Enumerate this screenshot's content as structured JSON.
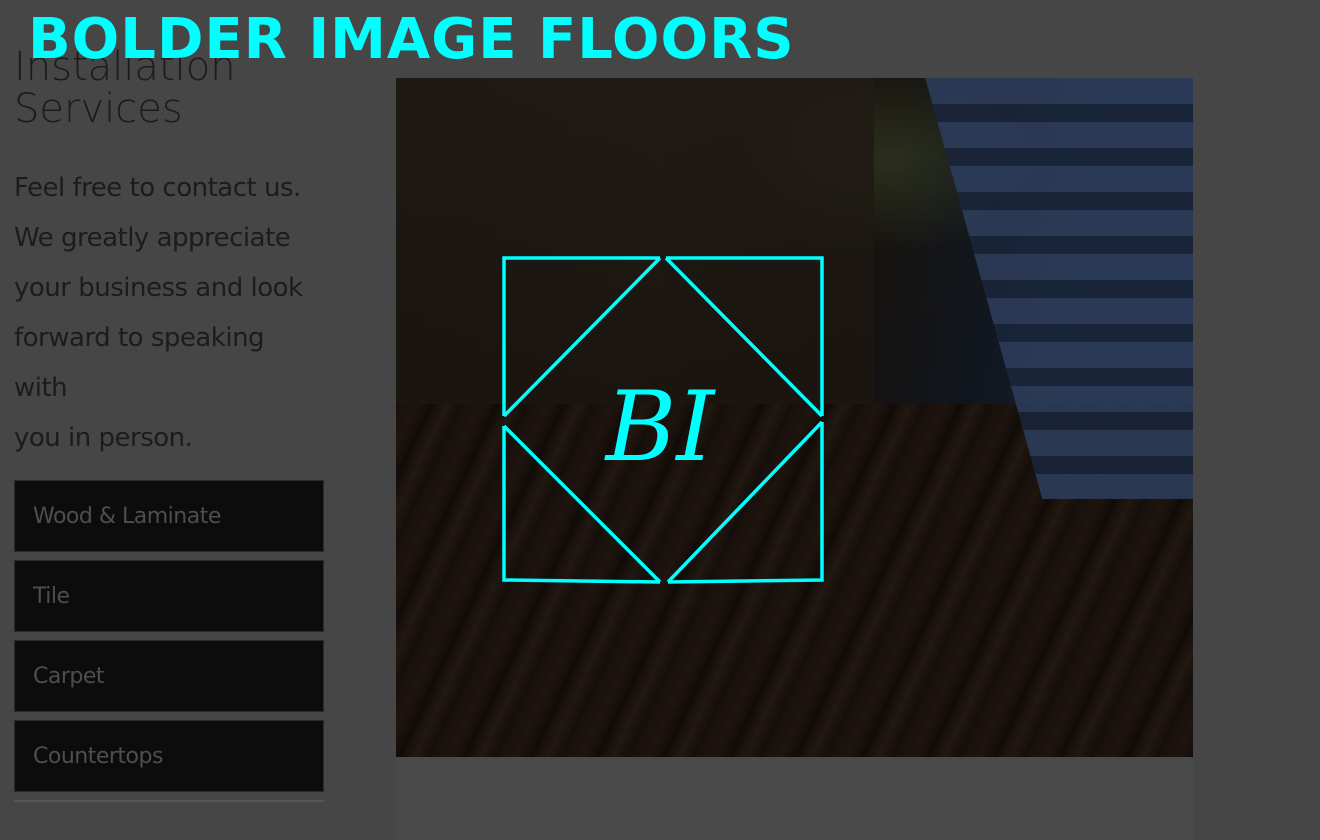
{
  "brand": {
    "title": "BOLDER IMAGE FLOORS"
  },
  "heading": {
    "line1": "Installation",
    "line2": "Services"
  },
  "intro": {
    "lines": [
      "Feel free to contact us.",
      "We greatly appreciate",
      "your business and look",
      "forward to speaking with",
      "you in person."
    ]
  },
  "services": [
    {
      "label": "Wood & Laminate"
    },
    {
      "label": "Tile"
    },
    {
      "label": "Carpet"
    },
    {
      "label": "Countertops"
    }
  ],
  "logo": {
    "monogram": "BI",
    "color": "#00ffff"
  },
  "colors": {
    "accent": "#00ffff",
    "overlay": "#464646"
  }
}
